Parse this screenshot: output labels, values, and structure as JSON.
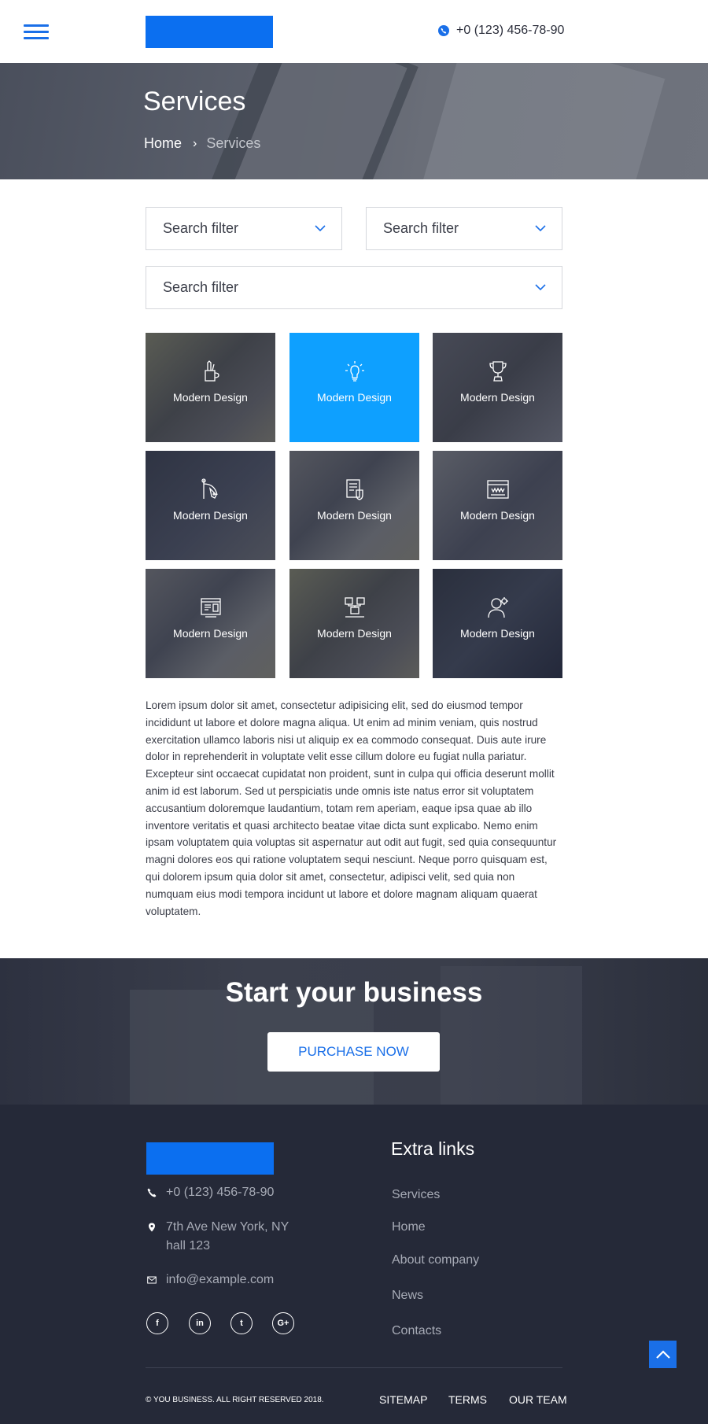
{
  "header": {
    "phone": "+0 (123) 456-78-90",
    "brand_color": "#0b6ff0"
  },
  "hero": {
    "title": "Services",
    "breadcrumb": [
      "Home",
      "Services"
    ],
    "breadcrumb_separator": "›"
  },
  "filters": [
    {
      "placeholder": "Search filter"
    },
    {
      "placeholder": "Search filter"
    },
    {
      "placeholder": "Search filter"
    }
  ],
  "services": [
    {
      "label": "Modern Design",
      "icon": "pencil-cup-icon"
    },
    {
      "label": "Modern Design",
      "icon": "lightbulb-icon",
      "active": true
    },
    {
      "label": "Modern Design",
      "icon": "trophy-icon"
    },
    {
      "label": "Modern Design",
      "icon": "design-tool-icon"
    },
    {
      "label": "Modern Design",
      "icon": "document-shield-icon"
    },
    {
      "label": "Modern Design",
      "icon": "browser-window-icon"
    },
    {
      "label": "Modern Design",
      "icon": "dashboard-icon"
    },
    {
      "label": "Modern Design",
      "icon": "network-icon"
    },
    {
      "label": "Modern Design",
      "icon": "user-gear-icon"
    }
  ],
  "accent_tile_color": "#0ea0ff",
  "description": "Lorem ipsum dolor sit amet, consectetur adipisicing elit, sed do eiusmod tempor incididunt ut labore et dolore magna aliqua. Ut enim ad minim veniam, quis nostrud exercitation ullamco laboris nisi ut aliquip ex ea commodo consequat. Duis aute irure dolor in reprehenderit in voluptate velit esse cillum dolore eu fugiat nulla pariatur. Excepteur sint occaecat cupidatat non proident, sunt in culpa qui officia deserunt mollit anim id est laborum. Sed ut perspiciatis unde omnis iste natus error sit voluptatem accusantium doloremque laudantium, totam rem aperiam, eaque ipsa quae ab illo inventore veritatis et quasi architecto beatae vitae dicta sunt explicabo. Nemo enim ipsam voluptatem quia voluptas sit aspernatur aut odit aut fugit, sed quia consequuntur magni dolores eos qui ratione voluptatem sequi nesciunt. Neque porro quisquam est, qui dolorem ipsum quia dolor sit amet, consectetur, adipisci velit, sed quia non numquam eius modi tempora incidunt ut labore et dolore magnam aliquam quaerat voluptatem.",
  "cta": {
    "title": "Start your business",
    "button": "PURCHASE NOW"
  },
  "footer": {
    "phone": "+0 (123) 456-78-90",
    "address_line1": "7th Ave New York, NY",
    "address_line2": "hall 123",
    "email": "info@example.com",
    "social": [
      {
        "icon": "facebook-icon",
        "glyph": "f"
      },
      {
        "icon": "linkedin-icon",
        "glyph": "in"
      },
      {
        "icon": "twitter-icon",
        "glyph": "t"
      },
      {
        "icon": "google-plus-icon",
        "glyph": "G+"
      }
    ],
    "extra_title": "Extra links",
    "extra_links": [
      "Services",
      "Home",
      "About company",
      "News",
      "Contacts"
    ],
    "copyright": "© YOU BUSINESS. ALL RIGHT RESERVED 2018.",
    "bottom_links": [
      "SITEMAP",
      "TERMS",
      "OUR TEAM"
    ]
  }
}
